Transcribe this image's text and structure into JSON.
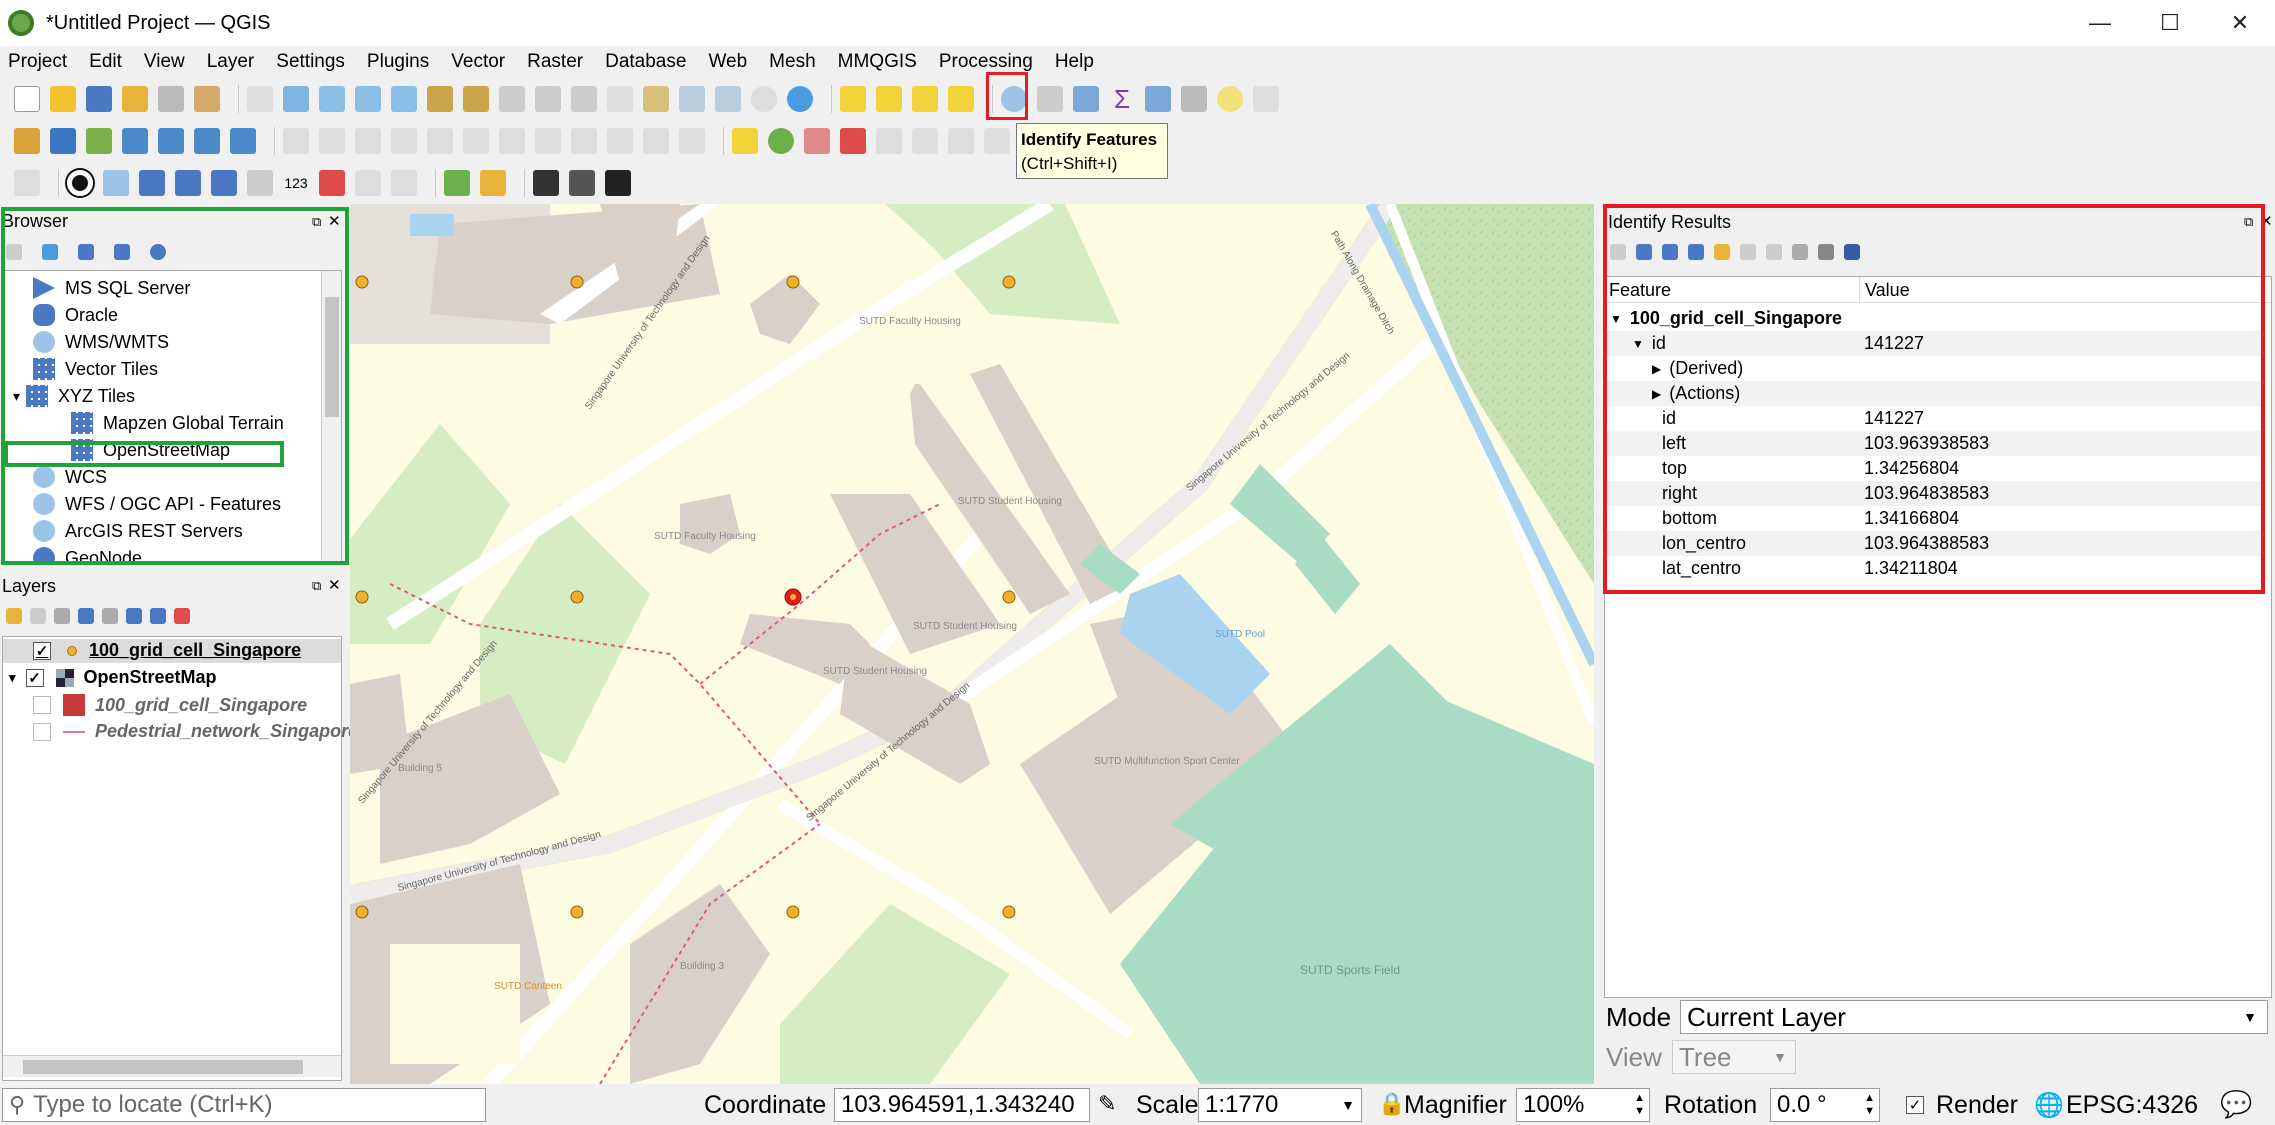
{
  "window": {
    "title": "*Untitled Project — QGIS",
    "min": "—",
    "max": "☐",
    "close": "✕"
  },
  "menu": [
    "Project",
    "Edit",
    "View",
    "Layer",
    "Settings",
    "Plugins",
    "Vector",
    "Raster",
    "Database",
    "Web",
    "Mesh",
    "MMQGIS",
    "Processing",
    "Help"
  ],
  "tooltip": {
    "title": "Identify Features",
    "shortcut": "(Ctrl+Shift+I)"
  },
  "browser": {
    "title": "Browser",
    "items": [
      "MS SQL Server",
      "Oracle",
      "WMS/WMTS",
      "Vector Tiles",
      "XYZ Tiles",
      "Mapzen Global Terrain",
      "OpenStreetMap",
      "WCS",
      "WFS / OGC API - Features",
      "ArcGIS REST Servers",
      "GeoNode"
    ]
  },
  "layers": {
    "title": "Layers",
    "items": [
      {
        "name": "100_grid_cell_Singapore",
        "checked": "✓"
      },
      {
        "name": "OpenStreetMap",
        "checked": "✓"
      },
      {
        "name": "100_grid_cell_Singapore",
        "checked": ""
      },
      {
        "name": "Pedestrial_network_Singapore",
        "checked": ""
      }
    ]
  },
  "identify": {
    "title": "Identify Results",
    "col_feature": "Feature",
    "col_value": "Value",
    "layer": "100_grid_cell_Singapore",
    "id_label": "id",
    "id_value": "141227",
    "derived": "(Derived)",
    "actions": "(Actions)",
    "attrs": [
      {
        "k": "id",
        "v": "141227"
      },
      {
        "k": "left",
        "v": "103.963938583"
      },
      {
        "k": "top",
        "v": "1.34256804"
      },
      {
        "k": "right",
        "v": "103.964838583"
      },
      {
        "k": "bottom",
        "v": "1.34166804"
      },
      {
        "k": "lon_centro",
        "v": "103.964388583"
      },
      {
        "k": "lat_centro",
        "v": "1.34211804"
      }
    ],
    "mode_label": "Mode",
    "mode_value": "Current Layer",
    "view_label": "View",
    "view_value": "Tree"
  },
  "map": {
    "labels": [
      "SUTD Faculty Housing",
      "SUTD Student Housing",
      "SUTD Student Housing",
      "SUTD Faculty Housing",
      "SUTD Student Housing",
      "SUTD Multifunction Sport Center",
      "SUTD Pool",
      "SUTD Sports Field",
      "Building 5",
      "Building 3",
      "SUTD Canteen",
      "Singapore University of Technology and Design",
      "Path Along Drainage Ditch"
    ]
  },
  "status": {
    "locate_placeholder": "Type to locate (Ctrl+K)",
    "coord_label": "Coordinate",
    "coord_value": "103.964591,1.343240",
    "scale_label": "Scale",
    "scale_value": "1:1770",
    "magnifier_label": "Magnifier",
    "magnifier_value": "100%",
    "rotation_label": "Rotation",
    "rotation_value": "0.0 °",
    "render_label": "Render",
    "render_checked": "✓",
    "crs": "EPSG:4326"
  }
}
